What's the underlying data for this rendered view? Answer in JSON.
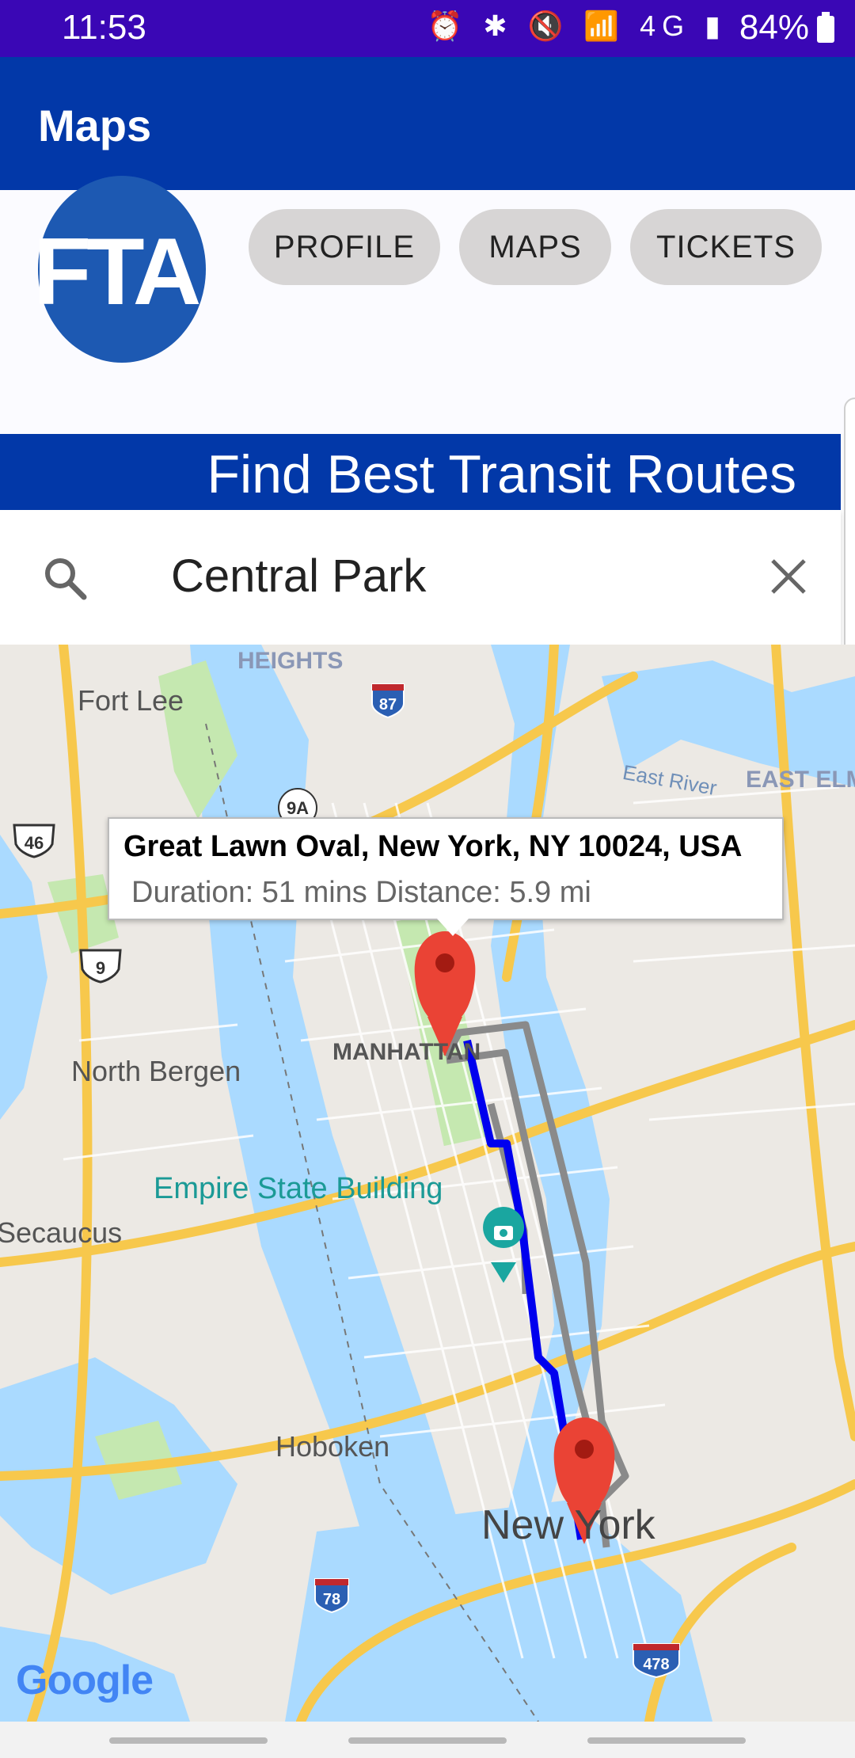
{
  "status_bar": {
    "time": "11:53",
    "icons": "⏰ ✱ 🔇 📶 4G ▮",
    "battery": "84%"
  },
  "app_bar": {
    "title": "Maps"
  },
  "logo": {
    "text": "FTA"
  },
  "nav": {
    "profile": "PROFILE",
    "maps": "MAPS",
    "tickets": "TICKETS"
  },
  "banner": {
    "title": "Find Best Transit Routes"
  },
  "search": {
    "value": "Central Park"
  },
  "map": {
    "labels": {
      "heights": "HEIGHTS",
      "fort_lee": "Fort Lee",
      "east_river": "East River",
      "east_elm": "EAST ELM",
      "north_bergen": "North Bergen",
      "manhattan": "MANHATTAN",
      "empire_state": "Empire State Building",
      "secaucus": "Secaucus",
      "hoboken": "Hoboken",
      "new_york": "New York"
    },
    "shields": {
      "i87": "87",
      "r9a": "9A",
      "us46": "46",
      "us9": "9",
      "i78": "78",
      "i478": "478"
    },
    "info_window": {
      "title": "Great Lawn Oval, New York, NY 10024, USA",
      "details": "Duration: 51 mins Distance: 5.9 mi"
    },
    "colors": {
      "water": "#aadaff",
      "land": "#ece9e4",
      "highway": "#f7c84c",
      "park": "#c5e8b0",
      "route_primary": "#0000ee",
      "route_alt": "#8a8a8a",
      "marker": "#ea4335"
    }
  },
  "attribution": {
    "google": "Google"
  }
}
